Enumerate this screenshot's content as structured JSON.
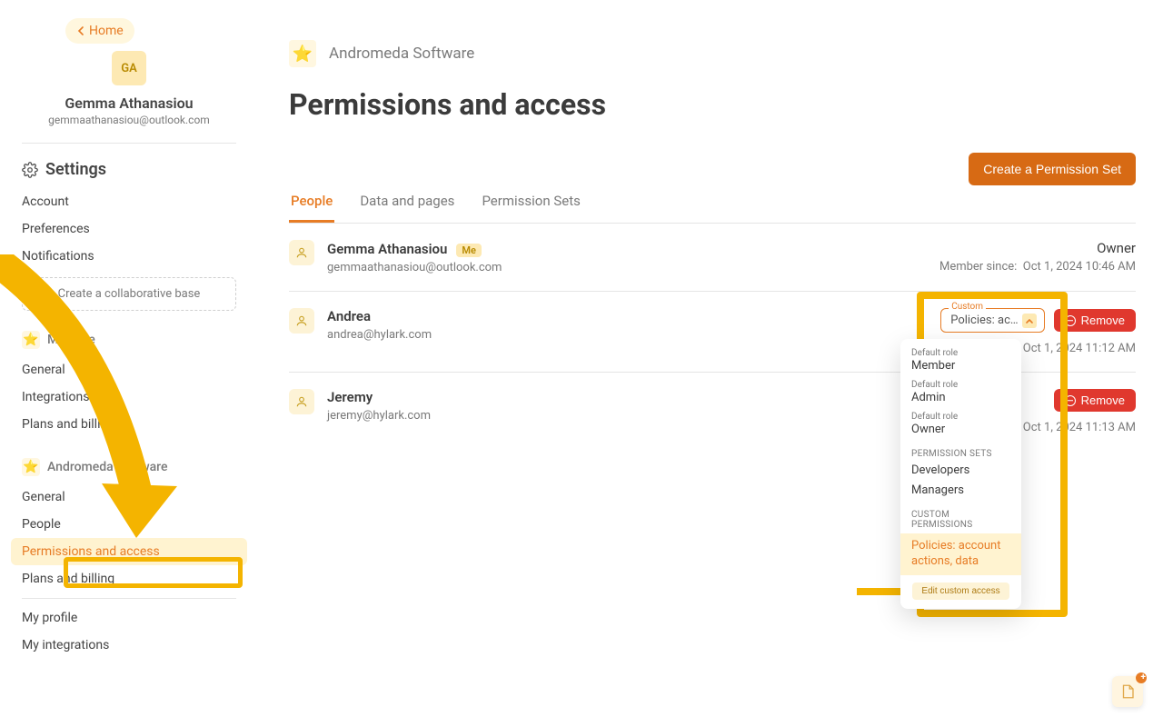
{
  "home_label": "Home",
  "user": {
    "initials": "GA",
    "name": "Gemma Athanasiou",
    "email": "gemmaathanasiou@outlook.com"
  },
  "settings_label": "Settings",
  "nav1": {
    "account": "Account",
    "preferences": "Preferences",
    "notifications": "Notifications",
    "create_base": "Create a collaborative base"
  },
  "section_base": "My base",
  "nav2": {
    "general": "General",
    "integrations": "Integrations",
    "plans": "Plans and billing"
  },
  "section_org": "Andromeda Software",
  "nav3": {
    "general": "General",
    "people": "People",
    "permissions": "Permissions and access",
    "plans": "Plans and billing",
    "profile": "My profile",
    "integrations": "My integrations"
  },
  "org_name": "Andromeda Software",
  "page_title": "Permissions and access",
  "cta": "Create a Permission Set",
  "tabs": {
    "people": "People",
    "data": "Data and pages",
    "sets": "Permission Sets"
  },
  "people": [
    {
      "name": "Gemma Athanasiou",
      "me": "Me",
      "email": "gemmaathanasiou@outlook.com",
      "role": "Owner",
      "since_label": "Member since:",
      "since": "Oct 1, 2024 10:46 AM"
    },
    {
      "name": "Andrea",
      "email": "andrea@hylark.com",
      "select_label": "Custom",
      "select_value": "Policies: ac…",
      "since": "Oct 1, 2024 11:12 AM",
      "remove": "Remove"
    },
    {
      "name": "Jeremy",
      "email": "jeremy@hylark.com",
      "since": "Oct 1, 2024 11:13 AM",
      "remove": "Remove"
    }
  ],
  "dd": {
    "default": "Default role",
    "member": "Member",
    "admin": "Admin",
    "owner": "Owner",
    "sets": "PERMISSION SETS",
    "developers": "Developers",
    "managers": "Managers",
    "custom": "CUSTOM PERMISSIONS",
    "policies": "Policies: account ac­tions, data",
    "edit": "Edit custom access"
  }
}
